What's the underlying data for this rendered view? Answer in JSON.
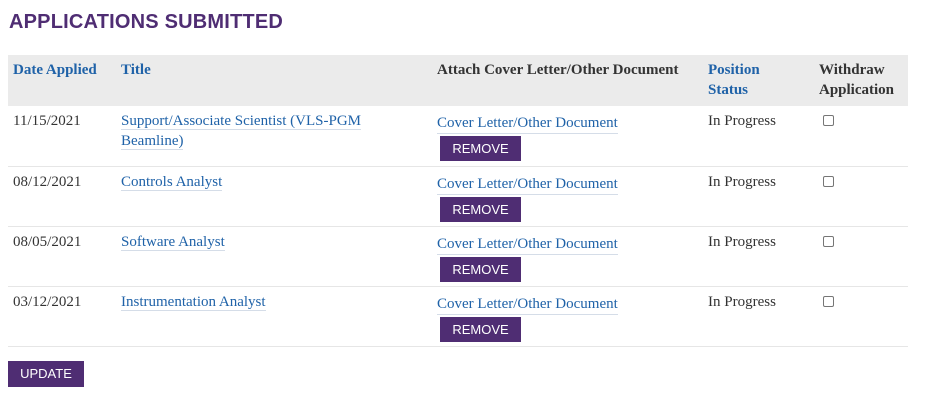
{
  "page": {
    "title": "APPLICATIONS SUBMITTED"
  },
  "table": {
    "headers": {
      "date_applied": "Date Applied",
      "title": "Title",
      "attach": "Attach Cover Letter/Other Document",
      "position_status_line1": "Position",
      "position_status_line2": "Status",
      "withdraw_line1": "Withdraw",
      "withdraw_line2": "Application"
    },
    "rows": [
      {
        "date": "11/15/2021",
        "title": "Support/Associate Scientist (VLS-PGM Beamline)",
        "doc_link": "Cover Letter/Other Document",
        "remove": "REMOVE",
        "status": "In Progress",
        "withdraw": false
      },
      {
        "date": "08/12/2021",
        "title": "Controls Analyst",
        "doc_link": "Cover Letter/Other Document",
        "remove": "REMOVE",
        "status": "In Progress",
        "withdraw": false
      },
      {
        "date": "08/05/2021",
        "title": "Software Analyst",
        "doc_link": "Cover Letter/Other Document",
        "remove": "REMOVE",
        "status": "In Progress",
        "withdraw": false
      },
      {
        "date": "03/12/2021",
        "title": "Instrumentation Analyst",
        "doc_link": "Cover Letter/Other Document",
        "remove": "REMOVE",
        "status": "In Progress",
        "withdraw": false
      }
    ]
  },
  "actions": {
    "update": "UPDATE"
  },
  "colors": {
    "brand": "#4f2d73",
    "link": "#1f62a8",
    "header_bg": "#ebebeb"
  }
}
